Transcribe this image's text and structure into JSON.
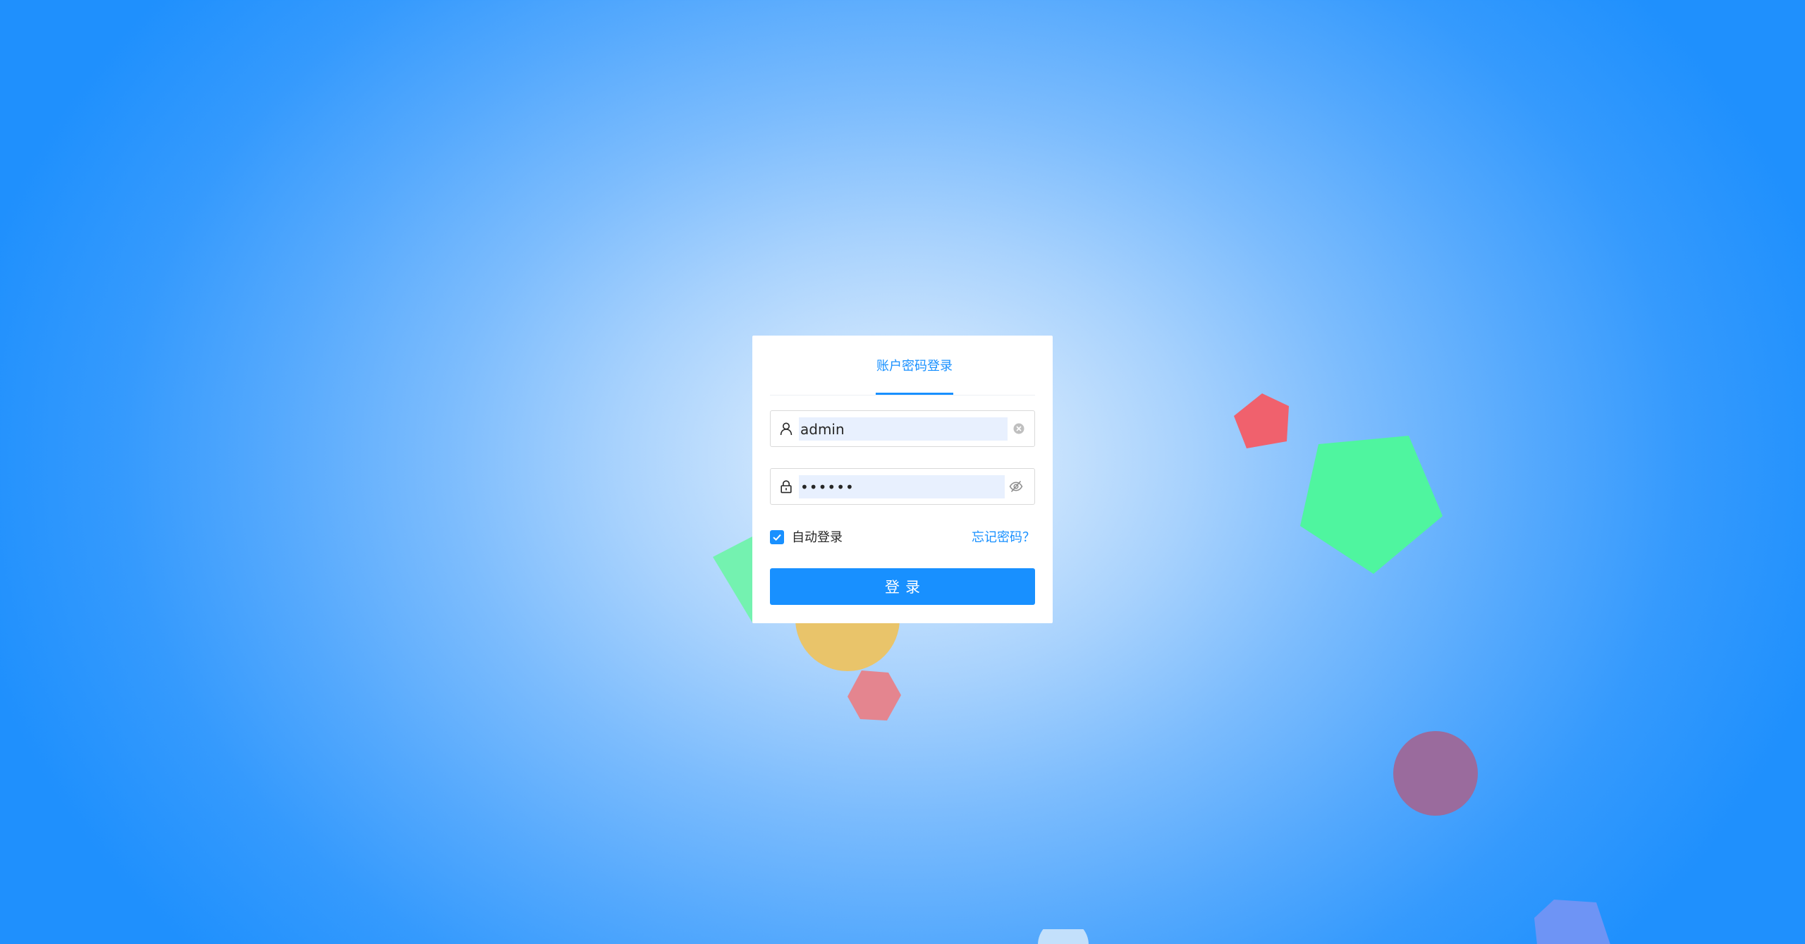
{
  "theme": {
    "accent": "#1890ff",
    "input_autofill_bg": "#e8f0fe",
    "card_bg": "#ffffff"
  },
  "login": {
    "tab_label": "账户密码登录",
    "username": {
      "icon": "user-icon",
      "value": "admin",
      "clear_icon": "clear-circle-icon"
    },
    "password": {
      "icon": "lock-icon",
      "value": "123456",
      "toggle_icon": "eye-invisible-icon"
    },
    "auto_login": {
      "label": "自动登录",
      "checked": true
    },
    "forgot_label": "忘记密码？",
    "submit_label": "登录"
  },
  "decorations": {
    "shapes": [
      {
        "name": "red-pentagon",
        "color": "#f0616d"
      },
      {
        "name": "green-pentagon",
        "color": "#4ff59f"
      },
      {
        "name": "green-triangle",
        "color": "#74f2b0"
      },
      {
        "name": "yellow-circle",
        "color": "#e9c46a"
      },
      {
        "name": "pink-hexagon",
        "color": "#e4858f"
      },
      {
        "name": "purple-circle",
        "color": "#9a6b9d"
      },
      {
        "name": "blue-pentagon",
        "color": "#6e94f5"
      },
      {
        "name": "light-circle",
        "color": "#c3e0fb"
      }
    ]
  }
}
